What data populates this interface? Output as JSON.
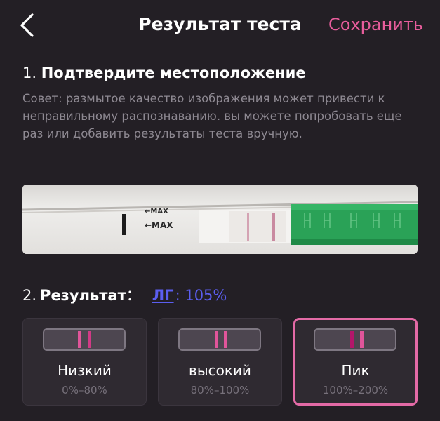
{
  "header": {
    "title": "Результат теста",
    "save_label": "Сохранить"
  },
  "section1": {
    "number": "1.",
    "title": "Подтвердите местоположение",
    "tip": "Совет: размытое качество изображения может привести к неправильному распознаванию. вы можете попробовать еще раз или добавить результаты теста вручную."
  },
  "strip": {
    "max_label": "←MAX",
    "max_label_top": "←MAX"
  },
  "section2": {
    "number": "2.",
    "label": "Результат",
    "colon": "：",
    "lg_label": "ЛГ",
    "lg_value": ": 105%"
  },
  "options": [
    {
      "name": "Низкий",
      "range": "0%–80%",
      "selected": false
    },
    {
      "name": "высокий",
      "range": "80%–100%",
      "selected": false
    },
    {
      "name": "Пик",
      "range": "100%–200%",
      "selected": true
    }
  ],
  "colors": {
    "accent": "#e85d9c",
    "lg": "#5b5ef0",
    "selected_border": "#e36aa6"
  }
}
